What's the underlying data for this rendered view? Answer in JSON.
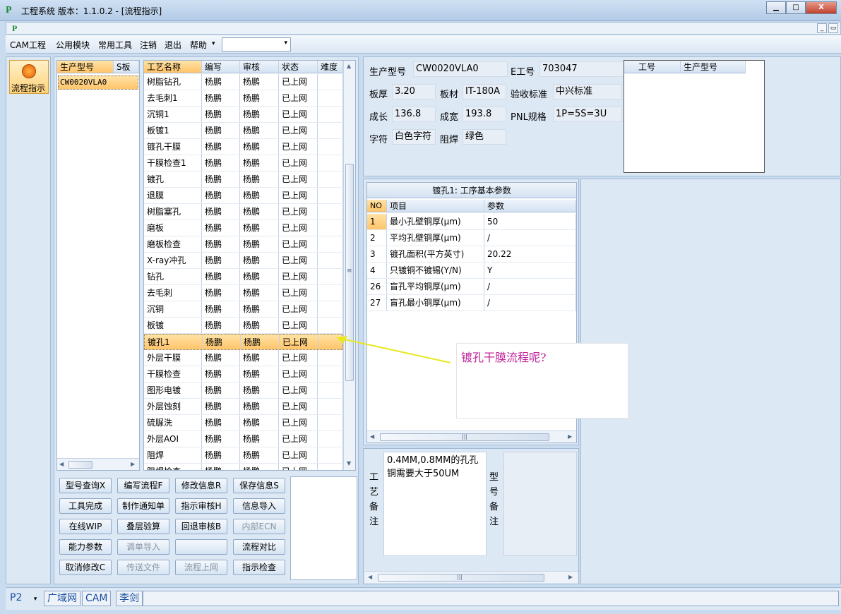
{
  "window": {
    "title": "工程系统  版本：1.1.0.2 - [流程指示]",
    "app_icon": "P",
    "min_glyph": "▁",
    "max_glyph": "□",
    "close_glyph": "X",
    "mdi_min_glyph": "_",
    "mdi_restore_glyph": "▭"
  },
  "menu": {
    "items": [
      "CAM工程",
      "公用模块",
      "常用工具",
      "注销",
      "退出",
      "帮助"
    ],
    "dropdown_arrow": "▾",
    "combo_value": "",
    "combo_arrow": "▾"
  },
  "nav": {
    "button_label": "流程指示"
  },
  "model_list": {
    "headers": [
      "生产型号",
      "S板"
    ],
    "rows": [
      "CW0020VLA0"
    ]
  },
  "process_grid": {
    "headers": [
      "工艺名称",
      "编写",
      "审核",
      "状态",
      "难度"
    ],
    "rows": [
      [
        "树脂钻孔",
        "杨鹏",
        "杨鹏",
        "已上网"
      ],
      [
        "去毛刺1",
        "杨鹏",
        "杨鹏",
        "已上网"
      ],
      [
        "沉铜1",
        "杨鹏",
        "杨鹏",
        "已上网"
      ],
      [
        "板镀1",
        "杨鹏",
        "杨鹏",
        "已上网"
      ],
      [
        "镀孔干膜",
        "杨鹏",
        "杨鹏",
        "已上网"
      ],
      [
        "干膜检查1",
        "杨鹏",
        "杨鹏",
        "已上网"
      ],
      [
        "镀孔",
        "杨鹏",
        "杨鹏",
        "已上网"
      ],
      [
        "退膜",
        "杨鹏",
        "杨鹏",
        "已上网"
      ],
      [
        "树脂塞孔",
        "杨鹏",
        "杨鹏",
        "已上网"
      ],
      [
        "磨板",
        "杨鹏",
        "杨鹏",
        "已上网"
      ],
      [
        "磨板检查",
        "杨鹏",
        "杨鹏",
        "已上网"
      ],
      [
        "X-ray冲孔",
        "杨鹏",
        "杨鹏",
        "已上网"
      ],
      [
        "钻孔",
        "杨鹏",
        "杨鹏",
        "已上网"
      ],
      [
        "去毛刺",
        "杨鹏",
        "杨鹏",
        "已上网"
      ],
      [
        "沉铜",
        "杨鹏",
        "杨鹏",
        "已上网"
      ],
      [
        "板镀",
        "杨鹏",
        "杨鹏",
        "已上网"
      ],
      [
        "镀孔1",
        "杨鹏",
        "杨鹏",
        "已上网"
      ],
      [
        "外层干膜",
        "杨鹏",
        "杨鹏",
        "已上网"
      ],
      [
        "干膜检查",
        "杨鹏",
        "杨鹏",
        "已上网"
      ],
      [
        "图形电镀",
        "杨鹏",
        "杨鹏",
        "已上网"
      ],
      [
        "外层蚀刻",
        "杨鹏",
        "杨鹏",
        "已上网"
      ],
      [
        "硫脲洗",
        "杨鹏",
        "杨鹏",
        "已上网"
      ],
      [
        "外层AOI",
        "杨鹏",
        "杨鹏",
        "已上网"
      ],
      [
        "阻焊",
        "杨鹏",
        "杨鹏",
        "已上网"
      ],
      [
        "阻焊检查",
        "杨鹏",
        "杨鹏",
        "已上网"
      ]
    ],
    "selected_index": 16
  },
  "buttons": [
    {
      "label": "型号查询X",
      "enabled": true
    },
    {
      "label": "编写流程F",
      "enabled": true
    },
    {
      "label": "修改信息R",
      "enabled": true
    },
    {
      "label": "保存信息S",
      "enabled": true
    },
    {
      "label": "工具完成",
      "enabled": true
    },
    {
      "label": "制作通知单",
      "enabled": true
    },
    {
      "label": "指示审核H",
      "enabled": true
    },
    {
      "label": "信息导入",
      "enabled": true
    },
    {
      "label": "在线WIP",
      "enabled": true
    },
    {
      "label": "叠层验算",
      "enabled": true
    },
    {
      "label": "回退审核B",
      "enabled": true
    },
    {
      "label": "内部ECN",
      "enabled": false
    },
    {
      "label": "能力参数",
      "enabled": true
    },
    {
      "label": "调单导入",
      "enabled": false
    },
    {
      "label": "",
      "enabled": true
    },
    {
      "label": "流程对比",
      "enabled": true
    },
    {
      "label": "取消修改C",
      "enabled": true
    },
    {
      "label": "传送文件",
      "enabled": false
    },
    {
      "label": "流程上网",
      "enabled": false
    },
    {
      "label": "指示检查",
      "enabled": true
    }
  ],
  "info": {
    "model_label": "生产型号",
    "model_value": "CW0020VLA0",
    "eno_label": "E工号",
    "eno_value": "703047",
    "thickness_label": "板厚",
    "thickness_value": "3.20",
    "material_label": "板材",
    "material_value": "IT-180A",
    "standard_label": "验收标准",
    "standard_value": "中兴标准",
    "length_label": "成长",
    "length_value": "136.8",
    "width_label": "成宽",
    "width_value": "193.8",
    "pnl_label": "PNL规格",
    "pnl_value": "1P=5S=3U",
    "char_label": "字符",
    "char_value": "白色字符",
    "mask_label": "阻焊",
    "mask_value": "绿色"
  },
  "right_mini_grid": {
    "headers": [
      "工号",
      "生产型号"
    ]
  },
  "param_grid": {
    "title": "镀孔1: 工序基本参数",
    "headers": [
      "NO",
      "项目",
      "参数"
    ],
    "rows": [
      [
        "1",
        "最小孔壁铜厚(μm)",
        "50"
      ],
      [
        "2",
        "平均孔壁铜厚(μm)",
        "/"
      ],
      [
        "3",
        "镀孔面积(平方英寸)",
        "20.22"
      ],
      [
        "4",
        "只镀铜不镀锡(Y/N)",
        "Y"
      ],
      [
        "26",
        "盲孔平均铜厚(μm)",
        "/"
      ],
      [
        "27",
        "盲孔最小铜厚(μm)",
        "/"
      ]
    ]
  },
  "annotation": {
    "text": "镀孔干膜流程呢?"
  },
  "notes": {
    "process_label": "工艺备注",
    "process_text": "0.4MM,0.8MM的孔孔铜需要大于50UM",
    "model_label": "型号备注",
    "model_text": ""
  },
  "statusbar": {
    "tabs": [
      "P2",
      "广域网",
      "CAM",
      "李剑"
    ],
    "p2_arrow": "▾"
  },
  "scroll_glyphs": {
    "up": "▲",
    "down": "▼",
    "left": "◀",
    "right": "▶",
    "grip": "≡",
    "hgrip": "|||"
  },
  "colors": {
    "accent_orange": "#ffc46a",
    "annotation_text": "#c0259a",
    "arrow": "#e8e820"
  }
}
